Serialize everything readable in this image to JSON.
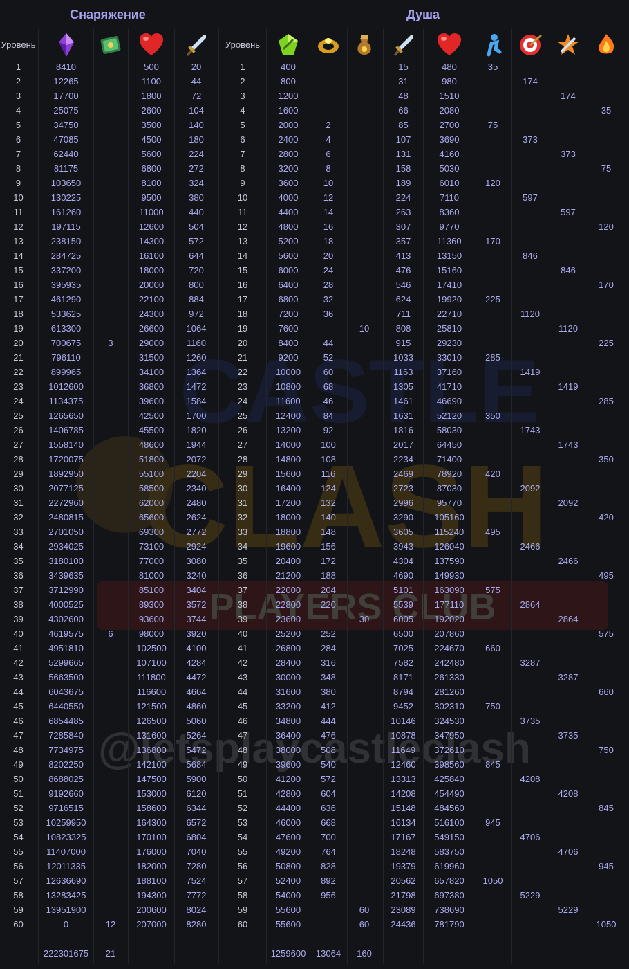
{
  "titles": {
    "equipment": "Снаряжение",
    "soul": "Душа"
  },
  "headers": {
    "level_label": "Уровень"
  },
  "icons": {
    "eq": [
      "level-text",
      "purple-crystal-icon",
      "green-book-icon",
      "red-heart-icon",
      "sword-icon"
    ],
    "soul": [
      "level-text",
      "green-gem-icon",
      "gold-ring-icon",
      "potion-pouch-icon",
      "sword-icon",
      "red-heart-icon",
      "blue-figure-icon",
      "target-icon",
      "star-hammer-icon",
      "fire-crystal-icon"
    ]
  },
  "colors": {
    "background": "#131418",
    "value": "#a9abef",
    "title": "#a6a3ef",
    "level": "#c6c9d6",
    "grid": "#23252c"
  },
  "watermark": {
    "brand_top": "CASTLE",
    "brand_bottom": "CLASH",
    "banner": "PLAYERS CLUB",
    "handle": "@letsplaycastleclash"
  },
  "totals": [
    "",
    "222301675",
    "21",
    "",
    "",
    "",
    "1259600",
    "13064",
    "160",
    "",
    "",
    "",
    "",
    "",
    ""
  ],
  "rows": [
    [
      "1",
      "8410",
      "",
      "500",
      "20",
      "1",
      "400",
      "",
      "",
      "15",
      "480",
      "35",
      "",
      "",
      ""
    ],
    [
      "2",
      "12265",
      "",
      "1100",
      "44",
      "2",
      "800",
      "",
      "",
      "31",
      "980",
      "",
      "174",
      "",
      ""
    ],
    [
      "3",
      "17700",
      "",
      "1800",
      "72",
      "3",
      "1200",
      "",
      "",
      "48",
      "1510",
      "",
      "",
      "174",
      ""
    ],
    [
      "4",
      "25075",
      "",
      "2600",
      "104",
      "4",
      "1600",
      "",
      "",
      "66",
      "2080",
      "",
      "",
      "",
      "35"
    ],
    [
      "5",
      "34750",
      "",
      "3500",
      "140",
      "5",
      "2000",
      "2",
      "",
      "85",
      "2700",
      "75",
      "",
      "",
      ""
    ],
    [
      "6",
      "47085",
      "",
      "4500",
      "180",
      "6",
      "2400",
      "4",
      "",
      "107",
      "3690",
      "",
      "373",
      "",
      ""
    ],
    [
      "7",
      "62440",
      "",
      "5600",
      "224",
      "7",
      "2800",
      "6",
      "",
      "131",
      "4160",
      "",
      "",
      "373",
      ""
    ],
    [
      "8",
      "81175",
      "",
      "6800",
      "272",
      "8",
      "3200",
      "8",
      "",
      "158",
      "5030",
      "",
      "",
      "",
      "75"
    ],
    [
      "9",
      "103650",
      "",
      "8100",
      "324",
      "9",
      "3600",
      "10",
      "",
      "189",
      "6010",
      "120",
      "",
      "",
      ""
    ],
    [
      "10",
      "130225",
      "",
      "9500",
      "380",
      "10",
      "4000",
      "12",
      "",
      "224",
      "7110",
      "",
      "597",
      "",
      ""
    ],
    [
      "11",
      "161260",
      "",
      "11000",
      "440",
      "11",
      "4400",
      "14",
      "",
      "263",
      "8360",
      "",
      "",
      "597",
      ""
    ],
    [
      "12",
      "197115",
      "",
      "12600",
      "504",
      "12",
      "4800",
      "16",
      "",
      "307",
      "9770",
      "",
      "",
      "",
      "120"
    ],
    [
      "13",
      "238150",
      "",
      "14300",
      "572",
      "13",
      "5200",
      "18",
      "",
      "357",
      "11360",
      "170",
      "",
      "",
      ""
    ],
    [
      "14",
      "284725",
      "",
      "16100",
      "644",
      "14",
      "5600",
      "20",
      "",
      "413",
      "13150",
      "",
      "846",
      "",
      ""
    ],
    [
      "15",
      "337200",
      "",
      "18000",
      "720",
      "15",
      "6000",
      "24",
      "",
      "476",
      "15160",
      "",
      "",
      "846",
      ""
    ],
    [
      "16",
      "395935",
      "",
      "20000",
      "800",
      "16",
      "6400",
      "28",
      "",
      "546",
      "17410",
      "",
      "",
      "",
      "170"
    ],
    [
      "17",
      "461290",
      "",
      "22100",
      "884",
      "17",
      "6800",
      "32",
      "",
      "624",
      "19920",
      "225",
      "",
      "",
      ""
    ],
    [
      "18",
      "533625",
      "",
      "24300",
      "972",
      "18",
      "7200",
      "36",
      "",
      "711",
      "22710",
      "",
      "1120",
      "",
      ""
    ],
    [
      "19",
      "613300",
      "",
      "26600",
      "1064",
      "19",
      "7600",
      "",
      "10",
      "808",
      "25810",
      "",
      "",
      "1120",
      ""
    ],
    [
      "20",
      "700675",
      "3",
      "29000",
      "1160",
      "20",
      "8400",
      "44",
      "",
      "915",
      "29230",
      "",
      "",
      "",
      "225"
    ],
    [
      "21",
      "796110",
      "",
      "31500",
      "1260",
      "21",
      "9200",
      "52",
      "",
      "1033",
      "33010",
      "285",
      "",
      "",
      ""
    ],
    [
      "22",
      "899965",
      "",
      "34100",
      "1364",
      "22",
      "10000",
      "60",
      "",
      "1163",
      "37160",
      "",
      "1419",
      "",
      ""
    ],
    [
      "23",
      "1012600",
      "",
      "36800",
      "1472",
      "23",
      "10800",
      "68",
      "",
      "1305",
      "41710",
      "",
      "",
      "1419",
      ""
    ],
    [
      "24",
      "1134375",
      "",
      "39600",
      "1584",
      "24",
      "11600",
      "46",
      "",
      "1461",
      "46690",
      "",
      "",
      "",
      "285"
    ],
    [
      "25",
      "1265650",
      "",
      "42500",
      "1700",
      "25",
      "12400",
      "84",
      "",
      "1631",
      "52120",
      "350",
      "",
      "",
      ""
    ],
    [
      "26",
      "1406785",
      "",
      "45500",
      "1820",
      "26",
      "13200",
      "92",
      "",
      "1816",
      "58030",
      "",
      "1743",
      "",
      ""
    ],
    [
      "27",
      "1558140",
      "",
      "48600",
      "1944",
      "27",
      "14000",
      "100",
      "",
      "2017",
      "64450",
      "",
      "",
      "1743",
      ""
    ],
    [
      "28",
      "1720075",
      "",
      "51800",
      "2072",
      "28",
      "14800",
      "108",
      "",
      "2234",
      "71400",
      "",
      "",
      "",
      "350"
    ],
    [
      "29",
      "1892950",
      "",
      "55100",
      "2204",
      "29",
      "15600",
      "116",
      "",
      "2469",
      "78920",
      "420",
      "",
      "",
      ""
    ],
    [
      "30",
      "2077125",
      "",
      "58500",
      "2340",
      "30",
      "16400",
      "124",
      "",
      "2723",
      "87030",
      "",
      "2092",
      "",
      ""
    ],
    [
      "31",
      "2272960",
      "",
      "62000",
      "2480",
      "31",
      "17200",
      "132",
      "",
      "2996",
      "95770",
      "",
      "",
      "2092",
      ""
    ],
    [
      "32",
      "2480815",
      "",
      "65600",
      "2624",
      "32",
      "18000",
      "140",
      "",
      "3290",
      "105160",
      "",
      "",
      "",
      "420"
    ],
    [
      "33",
      "2701050",
      "",
      "69300",
      "2772",
      "33",
      "18800",
      "148",
      "",
      "3605",
      "115240",
      "495",
      "",
      "",
      ""
    ],
    [
      "34",
      "2934025",
      "",
      "73100",
      "2924",
      "34",
      "19600",
      "156",
      "",
      "3943",
      "126040",
      "",
      "2466",
      "",
      ""
    ],
    [
      "35",
      "3180100",
      "",
      "77000",
      "3080",
      "35",
      "20400",
      "172",
      "",
      "4304",
      "137590",
      "",
      "",
      "2466",
      ""
    ],
    [
      "36",
      "3439635",
      "",
      "81000",
      "3240",
      "36",
      "21200",
      "188",
      "",
      "4690",
      "149930",
      "",
      "",
      "",
      "495"
    ],
    [
      "37",
      "3712990",
      "",
      "85100",
      "3404",
      "37",
      "22000",
      "204",
      "",
      "5101",
      "163090",
      "575",
      "",
      "",
      ""
    ],
    [
      "38",
      "4000525",
      "",
      "89300",
      "3572",
      "38",
      "22800",
      "220",
      "",
      "5539",
      "177110",
      "",
      "2864",
      "",
      ""
    ],
    [
      "39",
      "4302600",
      "",
      "93600",
      "3744",
      "39",
      "23600",
      "",
      "30",
      "6005",
      "192020",
      "",
      "",
      "2864",
      ""
    ],
    [
      "40",
      "4619575",
      "6",
      "98000",
      "3920",
      "40",
      "25200",
      "252",
      "",
      "6500",
      "207860",
      "",
      "",
      "",
      "575"
    ],
    [
      "41",
      "4951810",
      "",
      "102500",
      "4100",
      "41",
      "26800",
      "284",
      "",
      "7025",
      "224670",
      "660",
      "",
      "",
      ""
    ],
    [
      "42",
      "5299665",
      "",
      "107100",
      "4284",
      "42",
      "28400",
      "316",
      "",
      "7582",
      "242480",
      "",
      "3287",
      "",
      ""
    ],
    [
      "43",
      "5663500",
      "",
      "111800",
      "4472",
      "43",
      "30000",
      "348",
      "",
      "8171",
      "261330",
      "",
      "",
      "3287",
      ""
    ],
    [
      "44",
      "6043675",
      "",
      "116600",
      "4664",
      "44",
      "31600",
      "380",
      "",
      "8794",
      "281260",
      "",
      "",
      "",
      "660"
    ],
    [
      "45",
      "6440550",
      "",
      "121500",
      "4860",
      "45",
      "33200",
      "412",
      "",
      "9452",
      "302310",
      "750",
      "",
      "",
      ""
    ],
    [
      "46",
      "6854485",
      "",
      "126500",
      "5060",
      "46",
      "34800",
      "444",
      "",
      "10146",
      "324530",
      "",
      "3735",
      "",
      ""
    ],
    [
      "47",
      "7285840",
      "",
      "131600",
      "5264",
      "47",
      "36400",
      "476",
      "",
      "10878",
      "347950",
      "",
      "",
      "3735",
      ""
    ],
    [
      "48",
      "7734975",
      "",
      "136800",
      "5472",
      "48",
      "38000",
      "508",
      "",
      "11649",
      "372610",
      "",
      "",
      "",
      "750"
    ],
    [
      "49",
      "8202250",
      "",
      "142100",
      "5684",
      "49",
      "39600",
      "540",
      "",
      "12460",
      "398560",
      "845",
      "",
      "",
      ""
    ],
    [
      "50",
      "8688025",
      "",
      "147500",
      "5900",
      "50",
      "41200",
      "572",
      "",
      "13313",
      "425840",
      "",
      "4208",
      "",
      ""
    ],
    [
      "51",
      "9192660",
      "",
      "153000",
      "6120",
      "51",
      "42800",
      "604",
      "",
      "14208",
      "454490",
      "",
      "",
      "4208",
      ""
    ],
    [
      "52",
      "9716515",
      "",
      "158600",
      "6344",
      "52",
      "44400",
      "636",
      "",
      "15148",
      "484560",
      "",
      "",
      "",
      "845"
    ],
    [
      "53",
      "10259950",
      "",
      "164300",
      "6572",
      "53",
      "46000",
      "668",
      "",
      "16134",
      "516100",
      "945",
      "",
      "",
      ""
    ],
    [
      "54",
      "10823325",
      "",
      "170100",
      "6804",
      "54",
      "47600",
      "700",
      "",
      "17167",
      "549150",
      "",
      "4706",
      "",
      ""
    ],
    [
      "55",
      "11407000",
      "",
      "176000",
      "7040",
      "55",
      "49200",
      "764",
      "",
      "18248",
      "583750",
      "",
      "",
      "4706",
      ""
    ],
    [
      "56",
      "12011335",
      "",
      "182000",
      "7280",
      "56",
      "50800",
      "828",
      "",
      "19379",
      "619960",
      "",
      "",
      "",
      "945"
    ],
    [
      "57",
      "12636690",
      "",
      "188100",
      "7524",
      "57",
      "52400",
      "892",
      "",
      "20562",
      "657820",
      "1050",
      "",
      "",
      ""
    ],
    [
      "58",
      "13283425",
      "",
      "194300",
      "7772",
      "58",
      "54000",
      "956",
      "",
      "21798",
      "697380",
      "",
      "5229",
      "",
      ""
    ],
    [
      "59",
      "13951900",
      "",
      "200600",
      "8024",
      "59",
      "55600",
      "",
      "60",
      "23089",
      "738690",
      "",
      "",
      "5229",
      ""
    ],
    [
      "60",
      "0",
      "12",
      "207000",
      "8280",
      "60",
      "55600",
      "",
      "60",
      "24436",
      "781790",
      "",
      "",
      "",
      "1050"
    ]
  ]
}
